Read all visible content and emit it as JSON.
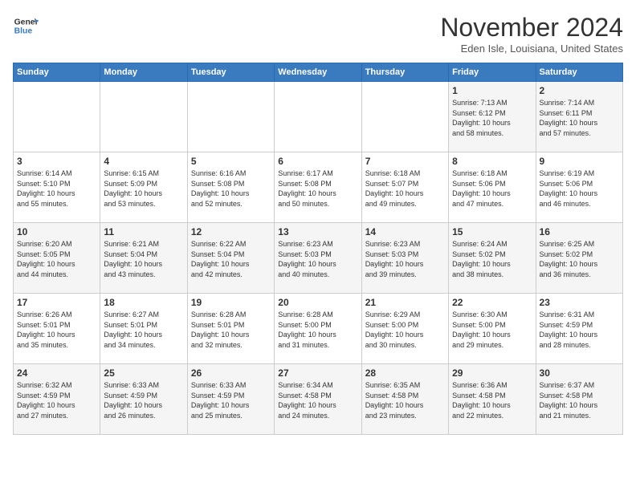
{
  "logo": {
    "line1": "General",
    "line2": "Blue"
  },
  "title": "November 2024",
  "subtitle": "Eden Isle, Louisiana, United States",
  "weekdays": [
    "Sunday",
    "Monday",
    "Tuesday",
    "Wednesday",
    "Thursday",
    "Friday",
    "Saturday"
  ],
  "weeks": [
    [
      {
        "day": "",
        "info": ""
      },
      {
        "day": "",
        "info": ""
      },
      {
        "day": "",
        "info": ""
      },
      {
        "day": "",
        "info": ""
      },
      {
        "day": "",
        "info": ""
      },
      {
        "day": "1",
        "info": "Sunrise: 7:13 AM\nSunset: 6:12 PM\nDaylight: 10 hours\nand 58 minutes."
      },
      {
        "day": "2",
        "info": "Sunrise: 7:14 AM\nSunset: 6:11 PM\nDaylight: 10 hours\nand 57 minutes."
      }
    ],
    [
      {
        "day": "3",
        "info": "Sunrise: 6:14 AM\nSunset: 5:10 PM\nDaylight: 10 hours\nand 55 minutes."
      },
      {
        "day": "4",
        "info": "Sunrise: 6:15 AM\nSunset: 5:09 PM\nDaylight: 10 hours\nand 53 minutes."
      },
      {
        "day": "5",
        "info": "Sunrise: 6:16 AM\nSunset: 5:08 PM\nDaylight: 10 hours\nand 52 minutes."
      },
      {
        "day": "6",
        "info": "Sunrise: 6:17 AM\nSunset: 5:08 PM\nDaylight: 10 hours\nand 50 minutes."
      },
      {
        "day": "7",
        "info": "Sunrise: 6:18 AM\nSunset: 5:07 PM\nDaylight: 10 hours\nand 49 minutes."
      },
      {
        "day": "8",
        "info": "Sunrise: 6:18 AM\nSunset: 5:06 PM\nDaylight: 10 hours\nand 47 minutes."
      },
      {
        "day": "9",
        "info": "Sunrise: 6:19 AM\nSunset: 5:06 PM\nDaylight: 10 hours\nand 46 minutes."
      }
    ],
    [
      {
        "day": "10",
        "info": "Sunrise: 6:20 AM\nSunset: 5:05 PM\nDaylight: 10 hours\nand 44 minutes."
      },
      {
        "day": "11",
        "info": "Sunrise: 6:21 AM\nSunset: 5:04 PM\nDaylight: 10 hours\nand 43 minutes."
      },
      {
        "day": "12",
        "info": "Sunrise: 6:22 AM\nSunset: 5:04 PM\nDaylight: 10 hours\nand 42 minutes."
      },
      {
        "day": "13",
        "info": "Sunrise: 6:23 AM\nSunset: 5:03 PM\nDaylight: 10 hours\nand 40 minutes."
      },
      {
        "day": "14",
        "info": "Sunrise: 6:23 AM\nSunset: 5:03 PM\nDaylight: 10 hours\nand 39 minutes."
      },
      {
        "day": "15",
        "info": "Sunrise: 6:24 AM\nSunset: 5:02 PM\nDaylight: 10 hours\nand 38 minutes."
      },
      {
        "day": "16",
        "info": "Sunrise: 6:25 AM\nSunset: 5:02 PM\nDaylight: 10 hours\nand 36 minutes."
      }
    ],
    [
      {
        "day": "17",
        "info": "Sunrise: 6:26 AM\nSunset: 5:01 PM\nDaylight: 10 hours\nand 35 minutes."
      },
      {
        "day": "18",
        "info": "Sunrise: 6:27 AM\nSunset: 5:01 PM\nDaylight: 10 hours\nand 34 minutes."
      },
      {
        "day": "19",
        "info": "Sunrise: 6:28 AM\nSunset: 5:01 PM\nDaylight: 10 hours\nand 32 minutes."
      },
      {
        "day": "20",
        "info": "Sunrise: 6:28 AM\nSunset: 5:00 PM\nDaylight: 10 hours\nand 31 minutes."
      },
      {
        "day": "21",
        "info": "Sunrise: 6:29 AM\nSunset: 5:00 PM\nDaylight: 10 hours\nand 30 minutes."
      },
      {
        "day": "22",
        "info": "Sunrise: 6:30 AM\nSunset: 5:00 PM\nDaylight: 10 hours\nand 29 minutes."
      },
      {
        "day": "23",
        "info": "Sunrise: 6:31 AM\nSunset: 4:59 PM\nDaylight: 10 hours\nand 28 minutes."
      }
    ],
    [
      {
        "day": "24",
        "info": "Sunrise: 6:32 AM\nSunset: 4:59 PM\nDaylight: 10 hours\nand 27 minutes."
      },
      {
        "day": "25",
        "info": "Sunrise: 6:33 AM\nSunset: 4:59 PM\nDaylight: 10 hours\nand 26 minutes."
      },
      {
        "day": "26",
        "info": "Sunrise: 6:33 AM\nSunset: 4:59 PM\nDaylight: 10 hours\nand 25 minutes."
      },
      {
        "day": "27",
        "info": "Sunrise: 6:34 AM\nSunset: 4:58 PM\nDaylight: 10 hours\nand 24 minutes."
      },
      {
        "day": "28",
        "info": "Sunrise: 6:35 AM\nSunset: 4:58 PM\nDaylight: 10 hours\nand 23 minutes."
      },
      {
        "day": "29",
        "info": "Sunrise: 6:36 AM\nSunset: 4:58 PM\nDaylight: 10 hours\nand 22 minutes."
      },
      {
        "day": "30",
        "info": "Sunrise: 6:37 AM\nSunset: 4:58 PM\nDaylight: 10 hours\nand 21 minutes."
      }
    ]
  ]
}
